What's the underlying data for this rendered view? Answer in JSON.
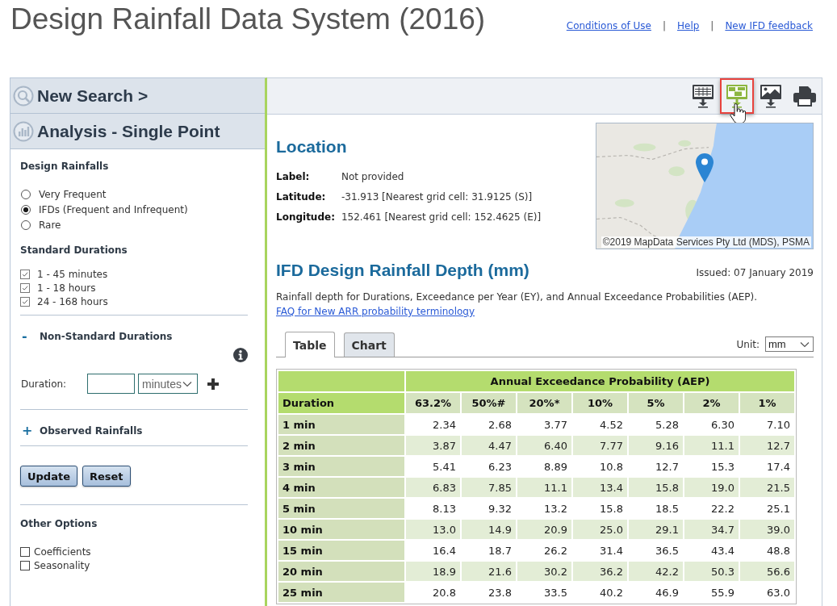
{
  "header": {
    "title": "Design Rainfall Data System (2016)",
    "nav": [
      {
        "kind": "link",
        "text": "Conditions of Use"
      },
      {
        "kind": "separator",
        "text": "|"
      },
      {
        "kind": "link",
        "text": "Help"
      },
      {
        "kind": "separator",
        "text": "|"
      },
      {
        "kind": "link",
        "text": "New IFD feedback"
      }
    ]
  },
  "sidebar": {
    "panels": [
      {
        "kind": "search",
        "title": "New Search >"
      },
      {
        "kind": "analysis",
        "title": "Analysis - Single Point"
      }
    ],
    "design_rainfalls": {
      "heading": "Design Rainfalls",
      "options": [
        {
          "label": "Very Frequent",
          "selected": false
        },
        {
          "label": "IFDs (Frequent and Infrequent)",
          "selected": true
        },
        {
          "label": "Rare",
          "selected": false
        }
      ]
    },
    "standard_durations": {
      "heading": "Standard Durations",
      "options": [
        {
          "label": "1 - 45 minutes",
          "checked": true
        },
        {
          "label": "1 - 18 hours",
          "checked": true
        },
        {
          "label": "24 - 168 hours",
          "checked": true
        }
      ]
    },
    "non_standard_durations": {
      "toggle": "-",
      "heading": "Non-Standard Durations",
      "duration_label": "Duration:",
      "unit": "minutes"
    },
    "observed_rainfalls": {
      "toggle": "+",
      "heading": "Observed Rainfalls"
    },
    "buttons": [
      "Update",
      "Reset"
    ],
    "other_options": {
      "heading": "Other Options",
      "options": [
        {
          "label": "Coefficients",
          "checked": false
        },
        {
          "label": "Seasonality",
          "checked": false
        }
      ]
    }
  },
  "toolbar": [
    {
      "kind": "table-export",
      "highlighted": false
    },
    {
      "kind": "chart-export",
      "highlighted": true
    },
    {
      "kind": "image-export",
      "highlighted": false
    },
    {
      "kind": "print",
      "highlighted": false
    }
  ],
  "map": {
    "attribution": "©2019 MapData Services Pty Ltd (MDS), PSMA"
  },
  "location": {
    "heading": "Location",
    "fields": [
      {
        "label": "Label:",
        "value": "Not provided"
      },
      {
        "label": "Latitude:",
        "value": "-31.913 [Nearest grid cell: 31.9125 (S)]"
      },
      {
        "label": "Longitude:",
        "value": "152.461 [Nearest grid cell: 152.4625 (E)]"
      }
    ]
  },
  "ifd": {
    "heading": "IFD Design Rainfall Depth (mm)",
    "issued": "Issued: 07 January 2019",
    "description": "Rainfall depth for Durations, Exceedance per Year (EY), and Annual Exceedance Probabilities (AEP).",
    "faq_link": "FAQ for New ARR probability terminology",
    "tabs": [
      {
        "label": "Table",
        "selected": true
      },
      {
        "label": "Chart",
        "selected": false
      }
    ],
    "unit_label": "Unit:",
    "unit": "mm",
    "table": {
      "group_header": "Annual Exceedance Probability (AEP)",
      "columns": [
        "Duration",
        "63.2%",
        "50%#",
        "20%*",
        "10%",
        "5%",
        "2%",
        "1%"
      ],
      "rows": [
        [
          "1 min",
          "2.34",
          "2.68",
          "3.77",
          "4.52",
          "5.28",
          "6.30",
          "7.10"
        ],
        [
          "2 min",
          "3.87",
          "4.47",
          "6.40",
          "7.77",
          "9.16",
          "11.1",
          "12.7"
        ],
        [
          "3 min",
          "5.41",
          "6.23",
          "8.89",
          "10.8",
          "12.7",
          "15.3",
          "17.4"
        ],
        [
          "4 min",
          "6.83",
          "7.85",
          "11.1",
          "13.4",
          "15.8",
          "19.0",
          "21.5"
        ],
        [
          "5 min",
          "8.13",
          "9.32",
          "13.2",
          "15.8",
          "18.5",
          "22.2",
          "25.1"
        ],
        [
          "10 min",
          "13.0",
          "14.9",
          "20.9",
          "25.0",
          "29.1",
          "34.7",
          "39.0"
        ],
        [
          "15 min",
          "16.4",
          "18.7",
          "26.2",
          "31.4",
          "36.5",
          "43.4",
          "48.8"
        ],
        [
          "20 min",
          "18.9",
          "21.6",
          "30.2",
          "36.2",
          "42.2",
          "50.3",
          "56.6"
        ],
        [
          "25 min",
          "20.8",
          "23.8",
          "33.5",
          "40.2",
          "46.9",
          "55.9",
          "63.0"
        ]
      ]
    }
  }
}
